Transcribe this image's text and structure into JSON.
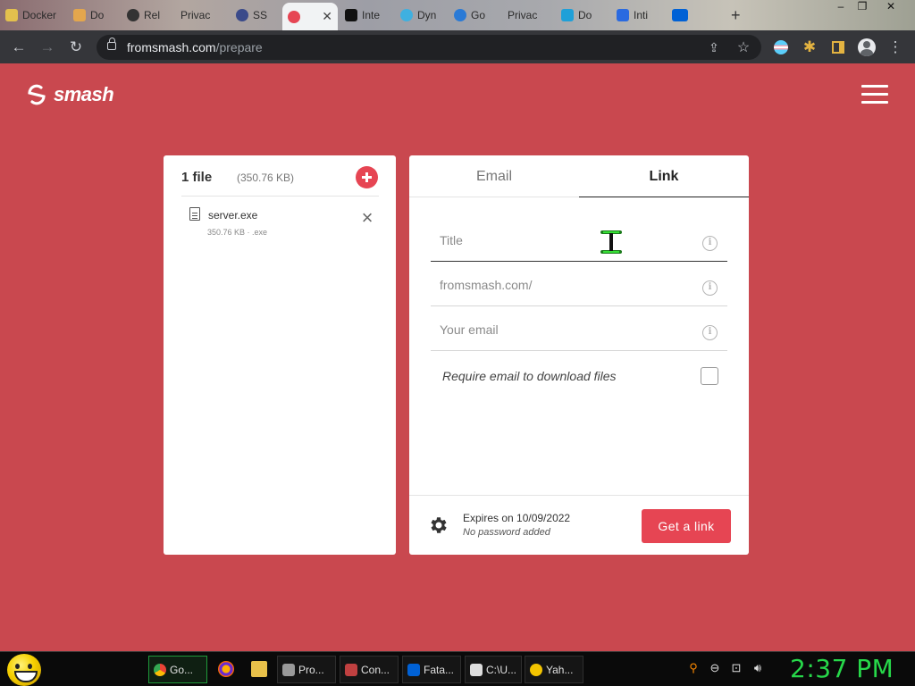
{
  "browser": {
    "tabs": [
      {
        "label": "Docker",
        "color": "#e3c04d"
      },
      {
        "label": "Do",
        "color": "#e3a64d"
      },
      {
        "label": "Rel",
        "color": "#333333"
      },
      {
        "label": "Privac",
        "color": "#8a8a8a"
      },
      {
        "label": "SS",
        "color": "#3a4a8a"
      },
      {
        "label": "Smash",
        "color": "#e64553"
      },
      {
        "label": "Inte",
        "color": "#111111"
      },
      {
        "label": "Dyn",
        "color": "#3fb0e0"
      },
      {
        "label": "Go",
        "color": "#2a7ad6"
      },
      {
        "label": "Privac",
        "color": "#8a8a8a"
      },
      {
        "label": "Do",
        "color": "#1fa0d8"
      },
      {
        "label": "Inti",
        "color": "#2a6ae0"
      },
      {
        "label": "box",
        "color": "#0061d5"
      }
    ],
    "url_domain": "fromsmash.com",
    "url_path": "/prepare"
  },
  "page": {
    "logo_text": "smash",
    "files": {
      "count_label": "1 file",
      "total_size": "(350.76 KB)",
      "items": [
        {
          "name": "server.exe",
          "meta": "350.76 KB · .exe"
        }
      ]
    },
    "form": {
      "tabs": {
        "email": "Email",
        "link": "Link"
      },
      "fields": {
        "title_placeholder": "Title",
        "url_placeholder": "fromsmash.com/",
        "email_placeholder": "Your email"
      },
      "info_glyph": "i",
      "require_email_label": "Require email to download files",
      "require_email_checked": false,
      "expires_text": "Expires on 10/09/2022",
      "password_text": "No password added",
      "get_link_label": "Get a link"
    }
  },
  "taskbar": {
    "tasks": [
      {
        "label": "Go...",
        "color": "#4285f4",
        "active": true
      },
      {
        "label": "Pro...",
        "color": "#9a9a9a",
        "active": false
      },
      {
        "label": "Con...",
        "color": "#c04040",
        "active": false
      },
      {
        "label": "Fata...",
        "color": "#0061d5",
        "active": false
      },
      {
        "label": "C:\\U...",
        "color": "#dddddd",
        "active": false
      },
      {
        "label": "Yah...",
        "color": "#f3c400",
        "active": false
      }
    ],
    "clock": "2:37 PM"
  },
  "colors": {
    "page_bg": "#c9484f",
    "accent": "#e64553",
    "clock": "#27d84a"
  }
}
